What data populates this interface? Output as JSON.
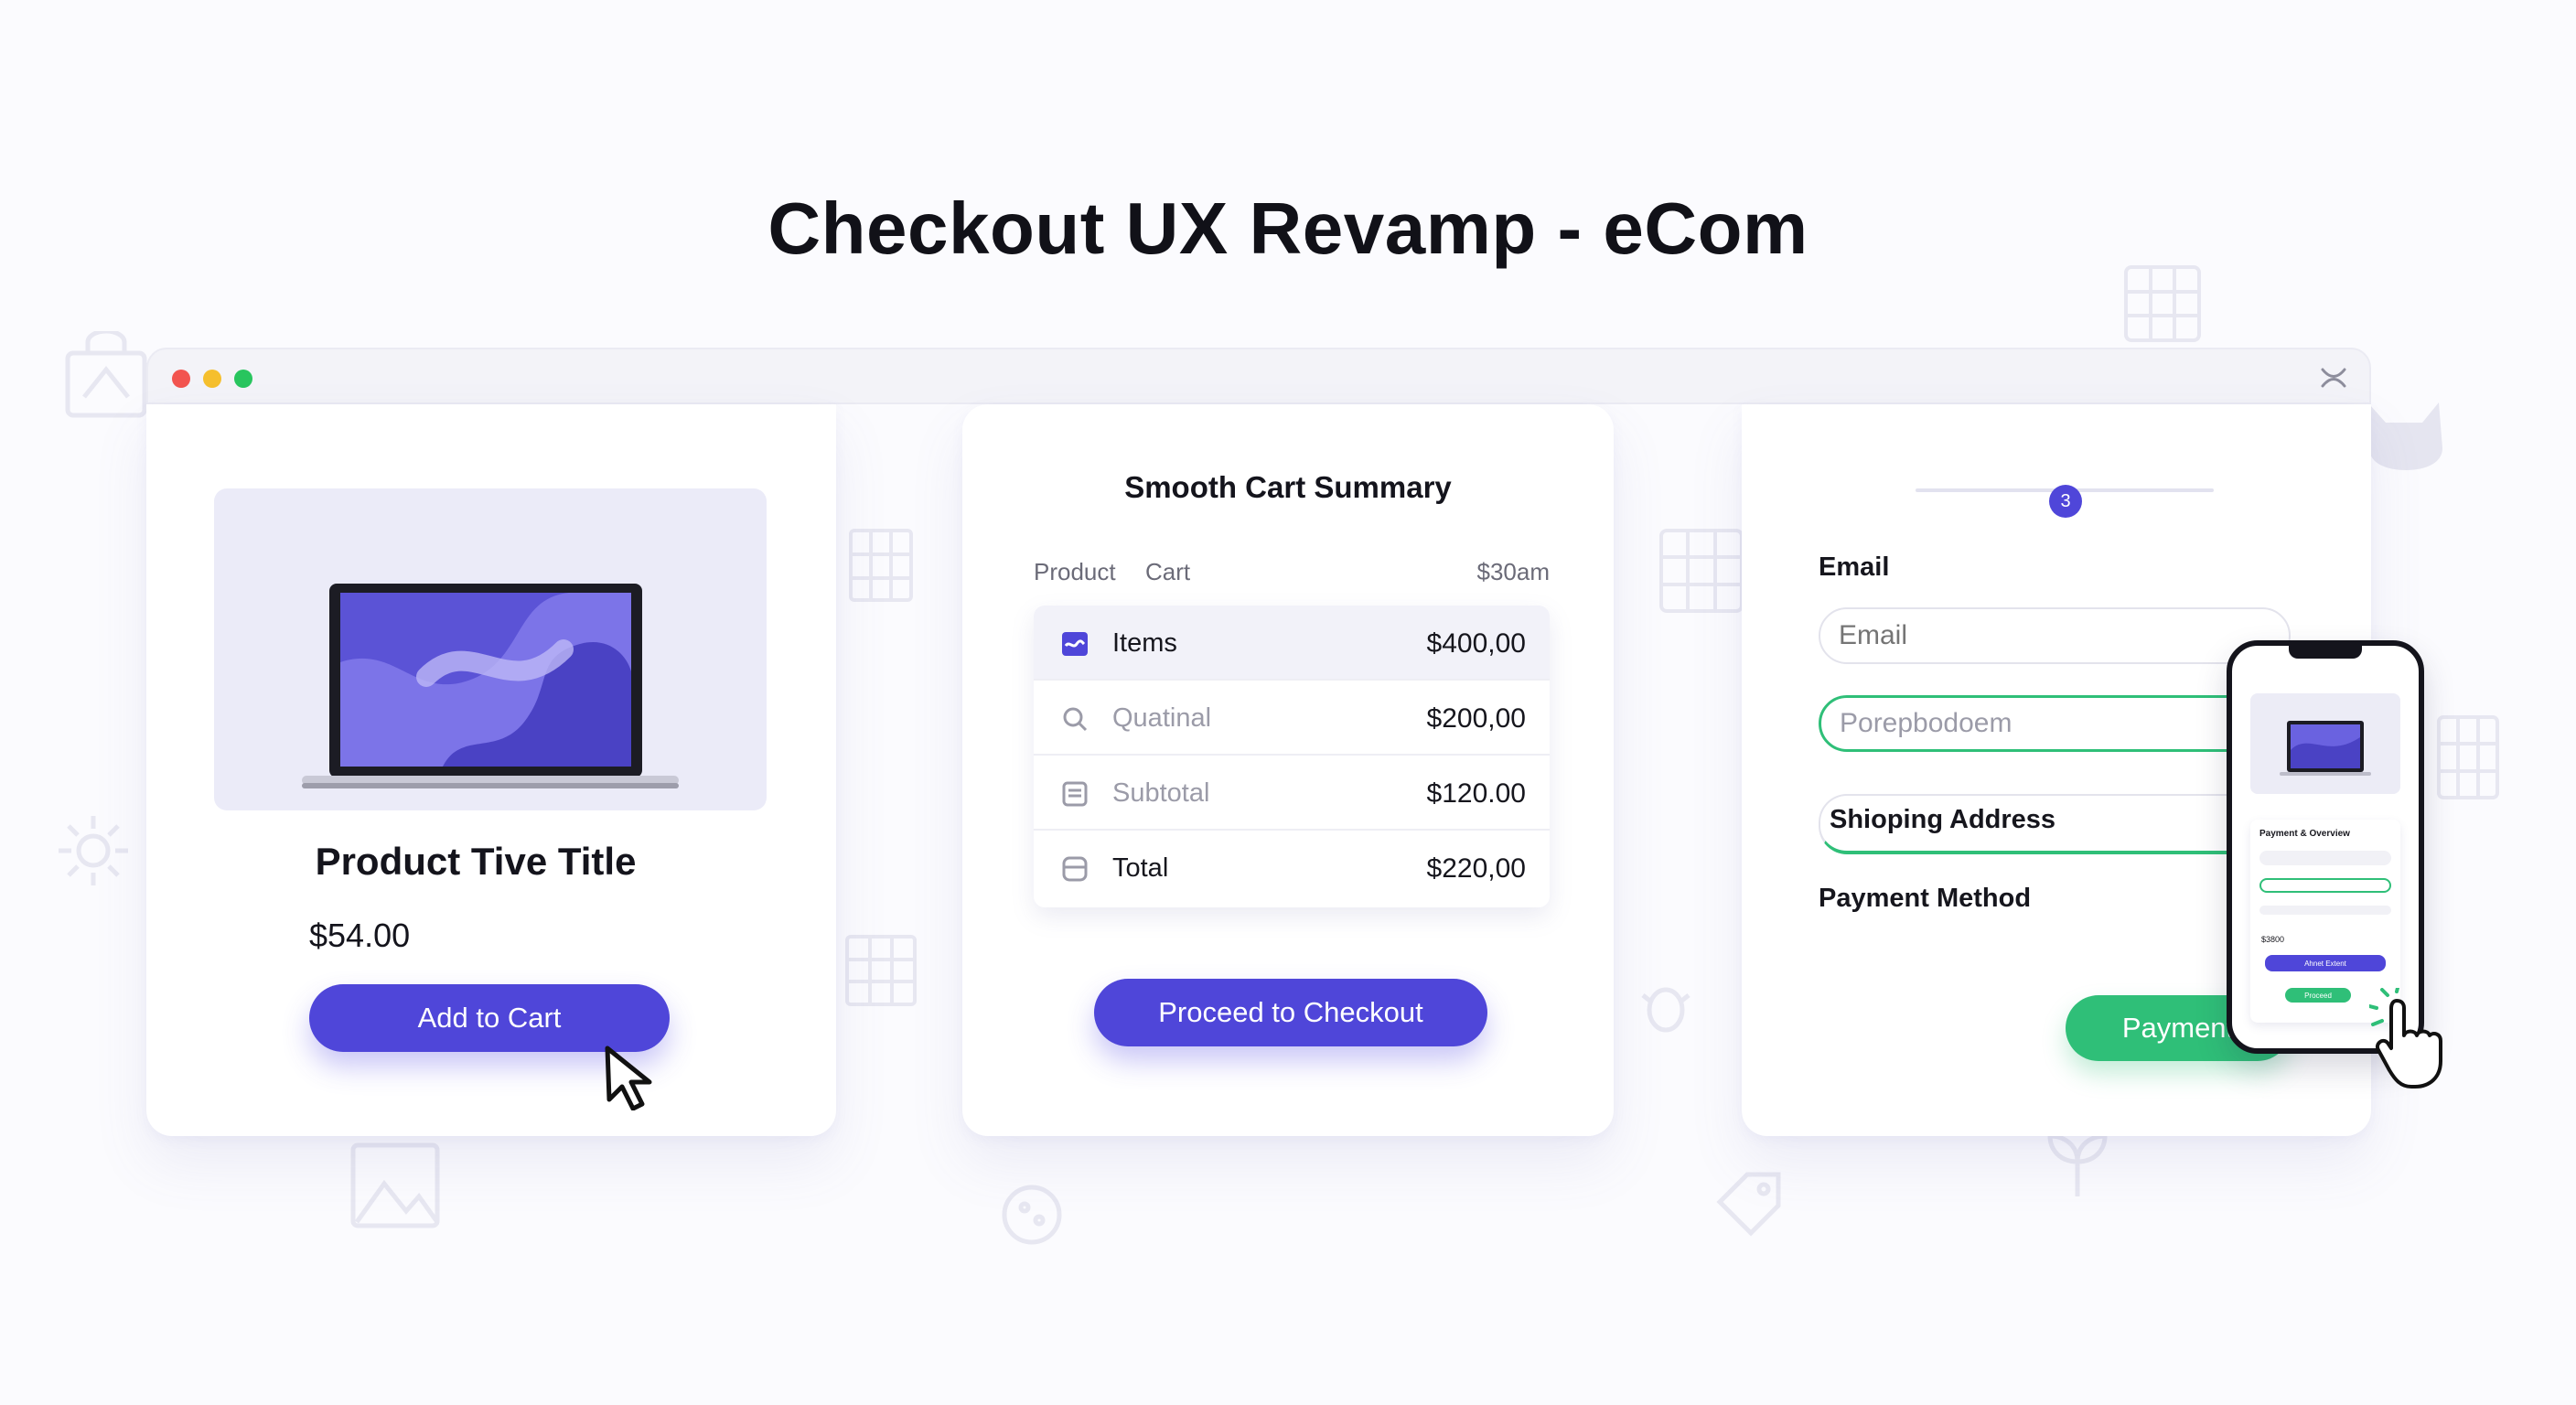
{
  "page": {
    "title": "Checkout UX Revamp - eCom"
  },
  "colors": {
    "accent": "#4f46d9",
    "success": "#2fbf78",
    "window_red": "#f2544f",
    "window_yellow": "#f5bf2d",
    "window_green": "#28c55e"
  },
  "icons": {
    "close": "close-icon",
    "cursor": "arrow-cursor-icon",
    "hand": "hand-pointer-icon"
  },
  "product_card": {
    "title": "Product Tive Title",
    "price": "$54.00",
    "add_to_cart_label": "Add to Cart"
  },
  "cart_summary": {
    "title": "Smooth Cart Summary",
    "headers": {
      "product": "Product",
      "cart": "Cart",
      "amount": "$30am"
    },
    "rows": [
      {
        "label": "Items",
        "value": "$400,00",
        "icon": "wave-card-icon"
      },
      {
        "label": "Quatinal",
        "value": "$200,00",
        "icon": "search-icon"
      },
      {
        "label": "Subtotal",
        "value": "$120.00",
        "icon": "receipt-icon"
      },
      {
        "label": "Total",
        "value": "$220,00",
        "icon": "box-icon"
      }
    ],
    "checkout_label": "Proceed to Checkout"
  },
  "checkout_form": {
    "step": "3",
    "email_label": "Email",
    "email_placeholder": "Email",
    "second_field_value": "Porepbodoem",
    "shipping_label": "Shioping Address",
    "payment_method_label": "Payment Method",
    "pay_label": "Payment"
  },
  "phone_preview": {
    "form_title": "Payment & Overview",
    "amount": "$3800",
    "primary_btn": "Ahnet Extent",
    "secondary_btn": "Proceed"
  }
}
